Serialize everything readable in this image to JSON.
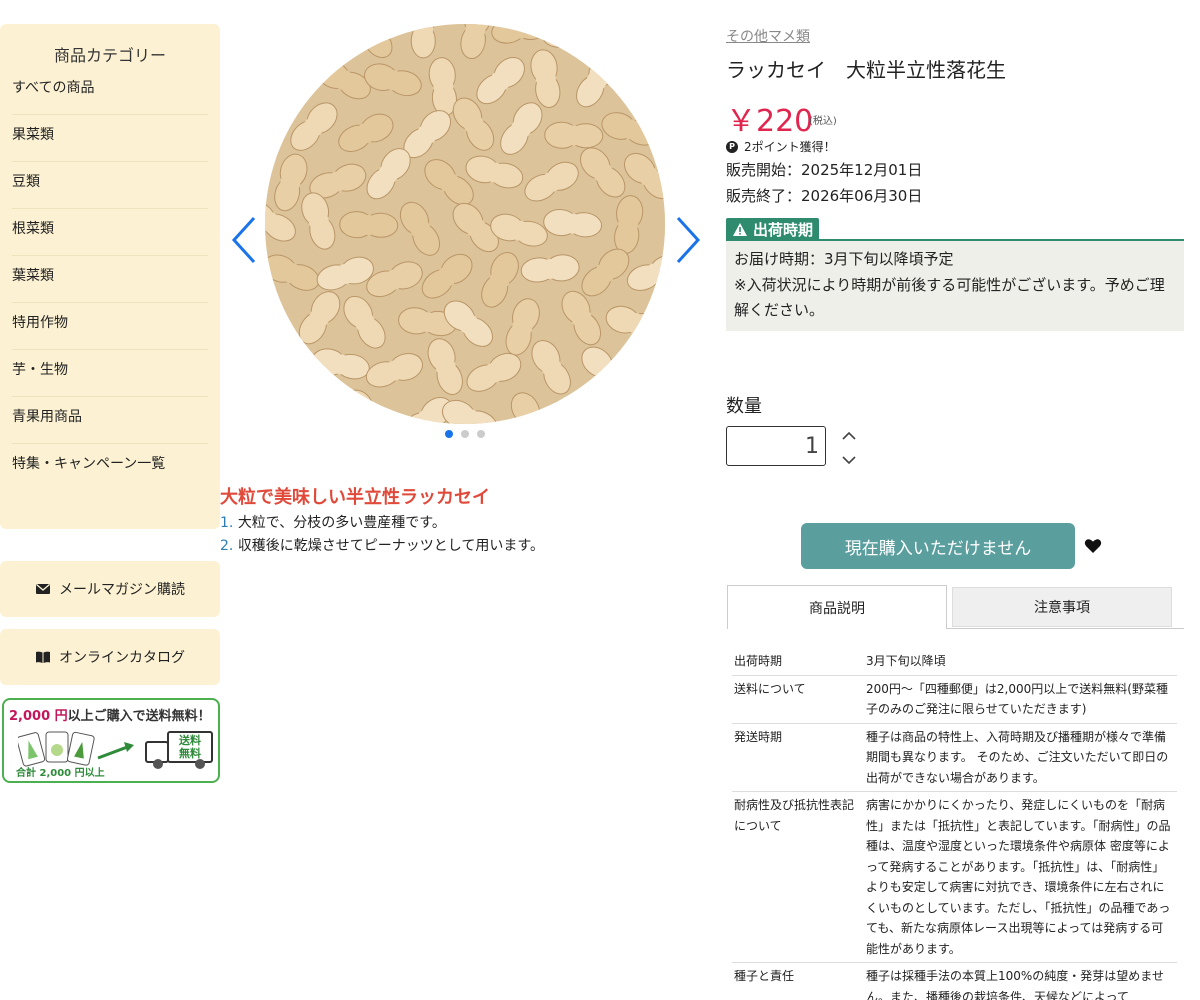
{
  "sidebar": {
    "category_title": "商品カテゴリー",
    "categories": [
      "すべての商品",
      "果菜類",
      "豆類",
      "根菜類",
      "葉菜類",
      "特用作物",
      "芋・生物",
      "青果用商品",
      "特集・キャンペーン一覧"
    ],
    "newsletter_label": "メールマガジン購読",
    "catalog_label": "オンラインカタログ",
    "banner": {
      "amount": "2,000 円",
      "text": "以上ご購入で送料無料！",
      "subtext": "合計 2,000 円以上",
      "truck_label_1": "送料",
      "truck_label_2": "無料"
    }
  },
  "gallery": {
    "image_icon": "peanuts-image",
    "prev_icon": "chevron-left-icon",
    "next_icon": "chevron-right-icon",
    "dot_count": 3,
    "active_dot": 0
  },
  "description": {
    "headline": "大粒で美味しい半立性ラッカセイ",
    "points": [
      {
        "num": "1.",
        "text": "大粒で、分枝の多い豊産種です。"
      },
      {
        "num": "2.",
        "text": "収穫後に乾燥させてピーナッツとして用います。"
      }
    ]
  },
  "product": {
    "category": "その他マメ類",
    "title": "ラッカセイ　大粒半立性落花生",
    "price": "￥220",
    "tax": "(税込)",
    "points_icon": "P",
    "points_text": "2ポイント獲得！",
    "sale_start": "販売開始：2025年12月01日",
    "sale_end": "販売終了：2026年06月30日",
    "shipping_label": "出荷時期",
    "shipping_line1": "お届け時期：3月下旬以降頃予定",
    "shipping_line2": "※入荷状況により時期が前後する可能性がございます。予めご理解ください。",
    "quantity_label": "数量",
    "quantity_value": "1",
    "buy_button": "現在購入いただけません",
    "tabs": [
      "商品説明",
      "注意事項"
    ]
  },
  "specs": [
    {
      "key": "出荷時期",
      "value": "3月下旬以降頃"
    },
    {
      "key": "送料について",
      "value": "200円〜「四種郵便」は2,000円以上で送料無料(野菜種子のみのご発注に限らせていただきます)"
    },
    {
      "key": "発送時期",
      "value": "種子は商品の特性上、入荷時期及び播種期が様々で準備期間も異なります。 そのため、ご注文いただいて即日の出荷ができない場合があります。"
    },
    {
      "key": "耐病性及び抵抗性表記について",
      "value": "病害にかかりにくかったり、発症しにくいものを「耐病性」または「抵抗性」と表記しています。「耐病性」の品種は、温度や湿度といった環境条件や病原体 密度等によって発病することがあります。「抵抗性」は、「耐病性」よりも安定して病害に対抗でき、環境条件に左右されにくいものとしています。ただし、「抵抗性」の品種であっても、新たな病原体レース出現等によっては発病する可能性があります。"
    },
    {
      "key": "種子と責任",
      "value": "種子は採種手法の本質上100%の純度・発芽は望めません。また、播種後の栽培条件、天候などによって"
    }
  ],
  "colors": {
    "sidebar_bg": "#fcf2d3",
    "price": "#e0264f",
    "headline": "#e04a3a",
    "accent_green": "#2e8b6e",
    "buy_button": "#5a9e9e"
  }
}
